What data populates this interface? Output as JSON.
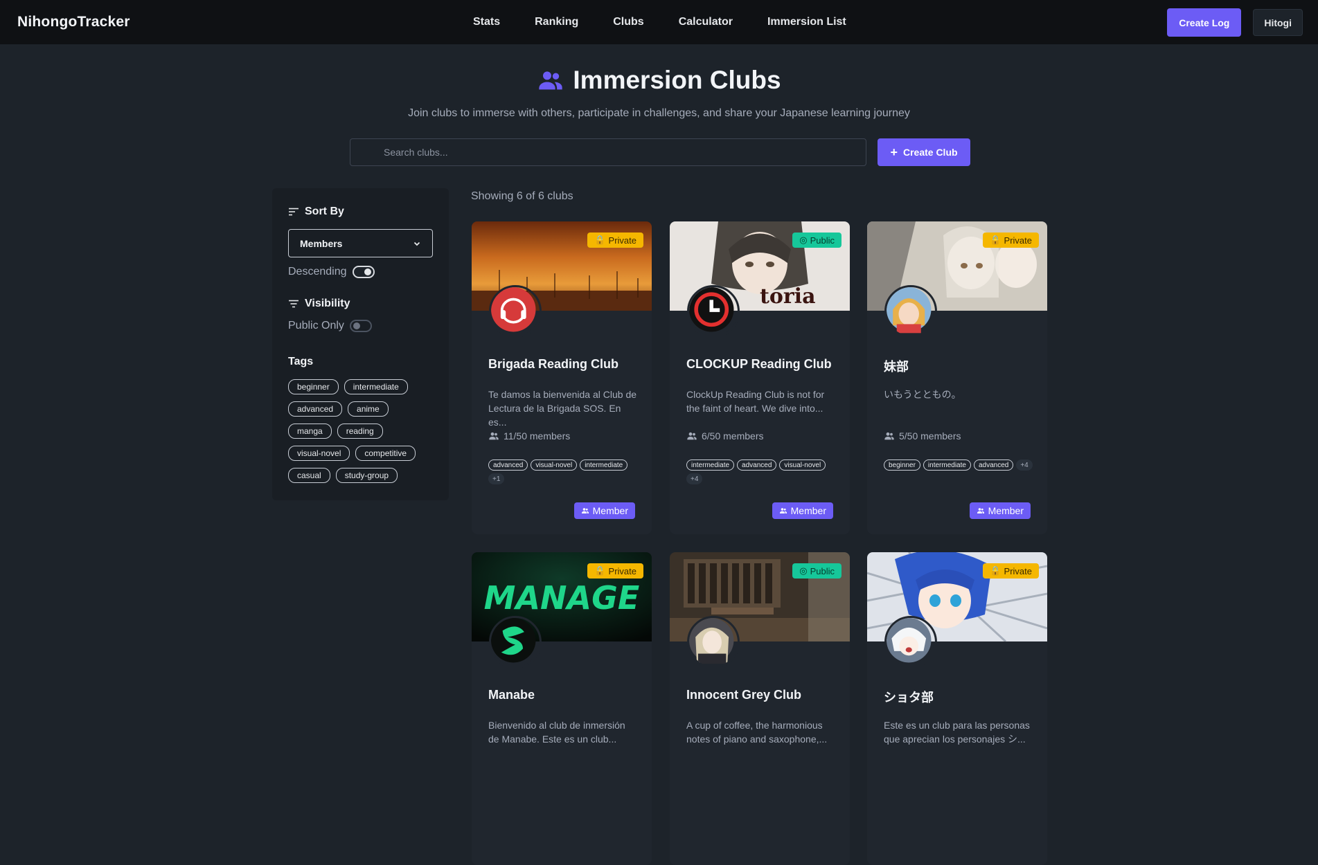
{
  "nav": {
    "brand": "NihongoTracker",
    "links": [
      "Stats",
      "Ranking",
      "Clubs",
      "Calculator",
      "Immersion List"
    ],
    "create_log": "Create Log",
    "user": "Hitogi"
  },
  "header": {
    "title": "Immersion Clubs",
    "subtitle": "Join clubs to immerse with others, participate in challenges, and share your Japanese learning journey"
  },
  "search": {
    "placeholder": "Search clubs...",
    "create_club": "Create Club"
  },
  "sidebar": {
    "sort_heading": "Sort By",
    "sort_value": "Members",
    "descending_label": "Descending",
    "visibility_heading": "Visibility",
    "public_only_label": "Public Only",
    "tags_heading": "Tags",
    "tags": [
      "beginner",
      "intermediate",
      "advanced",
      "anime",
      "manga",
      "reading",
      "visual-novel",
      "competitive",
      "casual",
      "study-group"
    ]
  },
  "showing": "Showing 6 of 6 clubs",
  "clubs": [
    {
      "name": "Brigada Reading Club",
      "visibility": "Private",
      "desc": "Te damos la bienvenida al Club de Lectura de la Brigada SOS. En es...",
      "members": "11/50 members",
      "tags": [
        "advanced",
        "visual-novel",
        "intermediate"
      ],
      "more": "+1",
      "action": "Member"
    },
    {
      "name": "CLOCKUP Reading Club",
      "visibility": "Public",
      "desc": "ClockUp Reading Club is not for the faint of heart. We dive into...",
      "members": "6/50 members",
      "tags": [
        "intermediate",
        "advanced",
        "visual-novel"
      ],
      "more": "+4",
      "action": "Member"
    },
    {
      "name": "妹部",
      "visibility": "Private",
      "desc": "いもうとともの。",
      "members": "5/50 members",
      "tags": [
        "beginner",
        "intermediate",
        "advanced"
      ],
      "more": "+4",
      "action": "Member"
    },
    {
      "name": "Manabe",
      "visibility": "Private",
      "desc": "Bienvenido al club de inmersión de Manabe. Este es un club...",
      "banner_text": "MANAGE"
    },
    {
      "name": "Innocent Grey Club",
      "visibility": "Public",
      "desc": "A cup of coffee, the harmonious notes of piano and saxophone,..."
    },
    {
      "name": "ショタ部",
      "visibility": "Private",
      "desc": "Este es un club para las personas que aprecian los personajes シ..."
    }
  ]
}
